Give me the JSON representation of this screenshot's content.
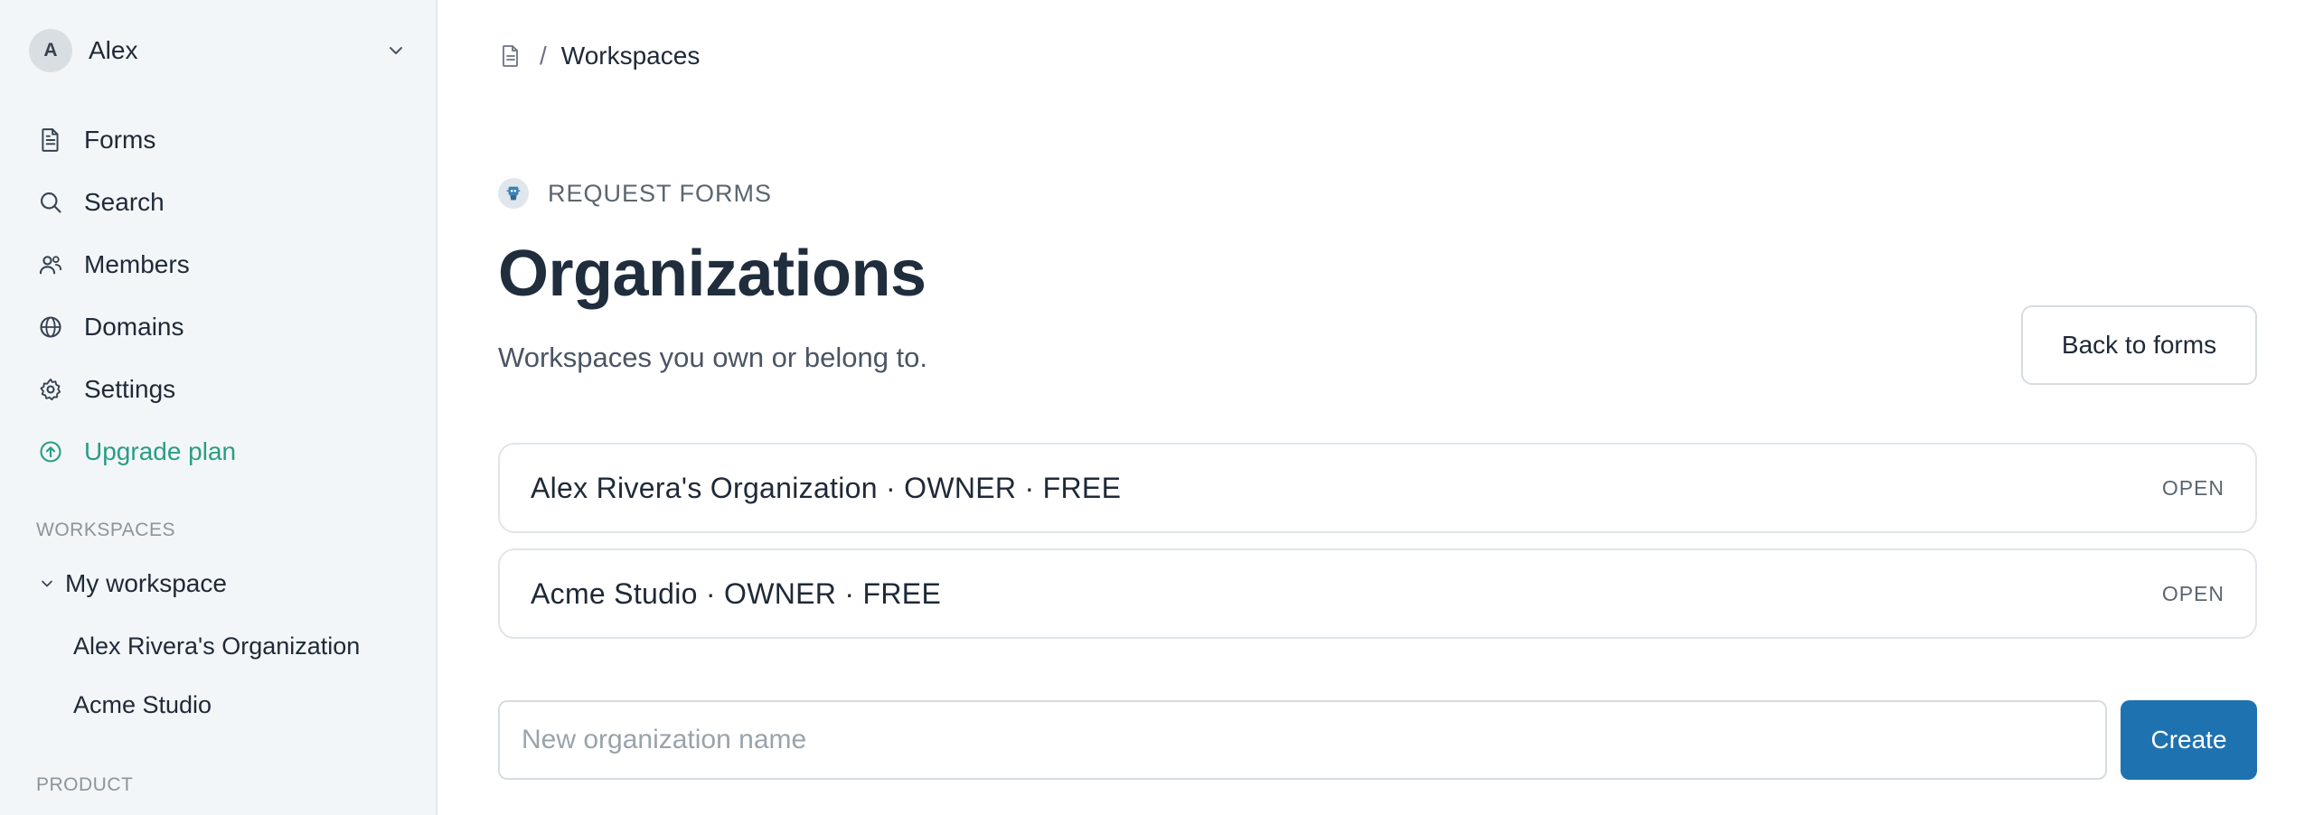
{
  "sidebar": {
    "user": {
      "initial": "A",
      "name": "Alex"
    },
    "nav": [
      {
        "label": "Forms",
        "icon": "document-icon"
      },
      {
        "label": "Search",
        "icon": "search-icon"
      },
      {
        "label": "Members",
        "icon": "members-icon"
      },
      {
        "label": "Domains",
        "icon": "globe-icon"
      },
      {
        "label": "Settings",
        "icon": "gear-icon"
      },
      {
        "label": "Upgrade plan",
        "icon": "arrow-up-circle-icon",
        "color": "#2a9d84"
      }
    ],
    "workspaces_label": "WORKSPACES",
    "workspace_group": "My workspace",
    "workspace_items": [
      "Alex Rivera's Organization",
      "Acme Studio"
    ],
    "product_label": "PRODUCT"
  },
  "breadcrumb": {
    "current": "Workspaces",
    "separator": "/"
  },
  "header": {
    "eyebrow": "REQUEST FORMS",
    "title": "Organizations",
    "subtitle": "Workspaces you own or belong to.",
    "back_button": "Back to forms"
  },
  "organizations": [
    {
      "label": "Alex Rivera's Organization · OWNER · FREE",
      "action": "OPEN"
    },
    {
      "label": "Acme Studio · OWNER · FREE",
      "action": "OPEN"
    }
  ],
  "create_form": {
    "placeholder": "New organization name",
    "button": "Create"
  },
  "colors": {
    "accent": "#1f72b0",
    "upgrade": "#2a9d84",
    "sidebar_bg": "#f3f6f8"
  }
}
